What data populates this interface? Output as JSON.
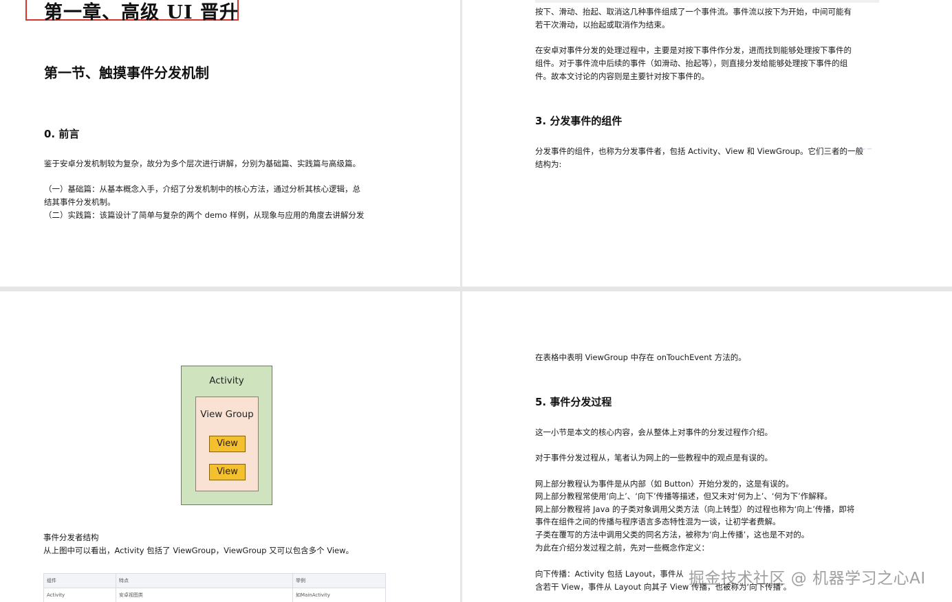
{
  "page1": {
    "chapter_title": "第一章、高级 UI 晋升",
    "section_title": "第一节、触摸事件分发机制",
    "heading_0": "0.  前言",
    "para_intro": "鉴于安卓分发机制较为复杂，故分为多个层次进行讲解，分别为基础篇、实践篇与高级篇。",
    "para_basic_1": "（一）基础篇：从基本概念入手，介绍了分发机制中的核心方法，通过分析其核心逻辑，总",
    "para_basic_2": "结其事件分发机制。",
    "para_practice": "（二）实践篇：该篇设计了简单与复杂的两个 demo 样例，从现象与应用的角度去讲解分发"
  },
  "page2": {
    "para_flow_1": "按下、滑动、抬起、取消这几种事件组成了一个事件流。事件流以按下为开始，中间可能有",
    "para_flow_2": "若干次滑动，以抬起或取消作为结束。",
    "para_process_1": "在安卓对事件分发的处理过程中，主要是对按下事件作分发，进而找到能够处理按下事件的",
    "para_process_2": "组件。对于事件流中后续的事件（如滑动、抬起等），则直接分发给能够处理按下事件的组",
    "para_process_3": "件。故本文讨论的内容则是主要针对按下事件的。",
    "heading_3": "3.  分发事件的组件",
    "para_components_1": "分发事件的组件，也称为分发事件者，包括 Activity、View 和 ViewGroup。它们三者的一般",
    "para_components_2": "结构为:"
  },
  "page3": {
    "diagram": {
      "activity": "Activity",
      "viewgroup": "View Group",
      "view_1": "View",
      "view_2": "View"
    },
    "caption": "事件分发者结构",
    "para_structure": "从上图中可以看出，Activity 包括了 ViewGroup，ViewGroup 又可以包含多个 View。",
    "table": {
      "headers": [
        "组件",
        "特点",
        "举例"
      ],
      "row": [
        "Activity",
        "安卓视图类",
        "如MainActivity"
      ]
    }
  },
  "page4": {
    "para_table_note": "在表格中表明 ViewGroup 中存在 onTouchEvent 方法的。",
    "heading_5": "5.  事件分发过程",
    "para_core": "这一小节是本文的核心内容，会从整体上对事件的分发过程作介绍。",
    "para_opinion": "对于事件分发过程从，笔者认为网上的一些教程中的观点是有误的。",
    "line_1": "网上部分教程认为事件是从内部（如 Button）开始分发的，这是有误的。",
    "line_2": "网上部分教程常使用‘向上’、‘向下’传播等描述，但又未对‘何为上’、‘何为下’作解释。",
    "line_3": "网上部分教程将 Java 的子类对象调用父类方法（向上转型）的过程也称为‘向上’传播，即将",
    "line_4": "事件在组件之间的传播与程序语言多态特性混为一谈，让初学者费解。",
    "line_5": "子类在覆写的方法中调用父类的同名方法，被称为‘向上传播’，这也是不对的。",
    "line_6": "为此在介绍分发过程之前，先对一些概念作定义：",
    "line_7": "向下传播：Activity 包括 Layout，事件从",
    "line_8": "含若干 View，事件从 Layout 向其子 View 传播，也被称为‘向下传播’。"
  },
  "watermark": "掘金技术社区 @ 机器学习之心AI",
  "colors": {
    "highlight_border": "#d9342b",
    "activity_fill": "#cfe3bf",
    "viewgroup_fill": "#f9e2d4",
    "view_fill": "#f5c02d"
  }
}
